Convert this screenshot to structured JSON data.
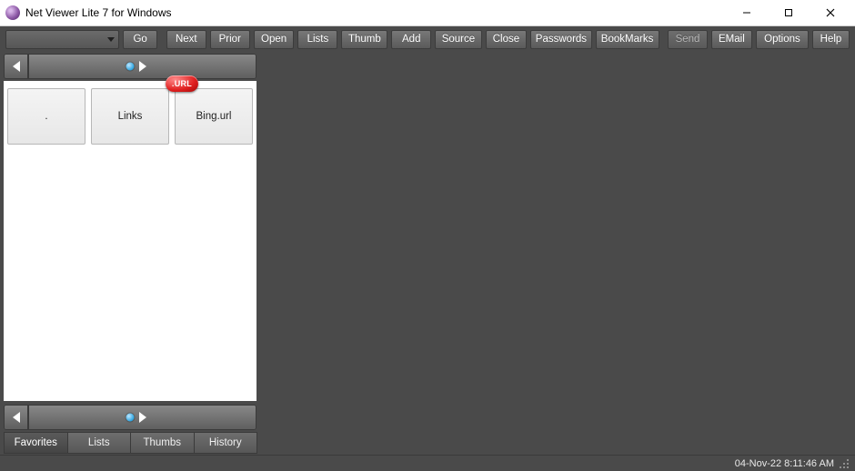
{
  "window": {
    "title": "Net Viewer Lite 7 for Windows"
  },
  "toolbar": {
    "go": "Go",
    "next": "Next",
    "prior": "Prior",
    "open": "Open",
    "lists": "Lists",
    "thumb": "Thumb",
    "add": "Add",
    "source": "Source",
    "close": "Close",
    "passwords": "Passwords",
    "bookmarks": "BookMarks",
    "send": "Send",
    "email": "EMail",
    "options": "Options",
    "help": "Help"
  },
  "tiles": {
    "items": [
      {
        "label": "."
      },
      {
        "label": "Links"
      },
      {
        "label": "Bing.url"
      }
    ],
    "badge": ".URL"
  },
  "tabs": {
    "items": [
      {
        "label": "Favorites",
        "active": true
      },
      {
        "label": "Lists",
        "active": false
      },
      {
        "label": "Thumbs",
        "active": false
      },
      {
        "label": "History",
        "active": false
      }
    ]
  },
  "status": {
    "datetime": "04-Nov-22 8:11:46 AM"
  }
}
